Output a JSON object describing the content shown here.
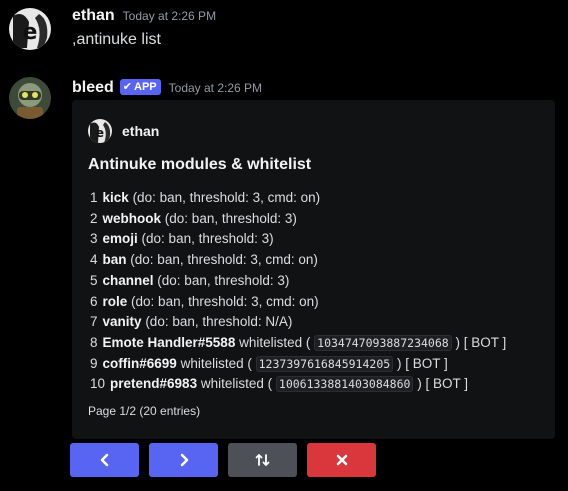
{
  "messages": [
    {
      "username": "ethan",
      "timestamp": "Today at 2:26 PM",
      "content": ",antinuke list"
    },
    {
      "username": "bleed",
      "badge": "APP",
      "timestamp": "Today at 2:26 PM",
      "embed": {
        "author": "ethan",
        "title": "Antinuke modules & whitelist",
        "items": [
          {
            "num": "1",
            "name": "kick",
            "detail": "(do: ban, threshold: 3, cmd: on)"
          },
          {
            "num": "2",
            "name": "webhook",
            "detail": "(do: ban, threshold: 3)"
          },
          {
            "num": "3",
            "name": "emoji",
            "detail": "(do: ban, threshold: 3)"
          },
          {
            "num": "4",
            "name": "ban",
            "detail": "(do: ban, threshold: 3, cmd: on)"
          },
          {
            "num": "5",
            "name": "channel",
            "detail": "(do: ban, threshold: 3)"
          },
          {
            "num": "6",
            "name": "role",
            "detail": "(do: ban, threshold: 3, cmd: on)"
          },
          {
            "num": "7",
            "name": "vanity",
            "detail": "(do: ban, threshold: N/A)"
          },
          {
            "num": "8",
            "name": "Emote Handler#5588",
            "detail": "whitelisted (",
            "id": "1034747093887234068",
            "suffix": ") [",
            "tag": "BOT",
            "end": "]"
          },
          {
            "num": "9",
            "name": "coffin#6699",
            "detail": "whitelisted (",
            "id": "1237397616845914205",
            "suffix": ") [",
            "tag": "BOT",
            "end": "]"
          },
          {
            "num": "10",
            "name": "pretend#6983",
            "detail": "whitelisted (",
            "id": "1006133881403084860",
            "suffix": ") [",
            "tag": "BOT",
            "end": "]"
          }
        ],
        "footer": "Page 1/2 (20 entries)"
      },
      "buttons": [
        {
          "label": "<",
          "icon": "chevron-left-icon",
          "style": "primary"
        },
        {
          "label": ">",
          "icon": "chevron-right-icon",
          "style": "primary"
        },
        {
          "label": "↑↓",
          "icon": "sort-icon",
          "style": "secondary"
        },
        {
          "label": "✕",
          "icon": "close-icon",
          "style": "danger"
        }
      ]
    }
  ],
  "colors": {
    "background": "#000000",
    "embed_bg": "#111214",
    "blurple": "#5865f2",
    "secondary": "#4e5058",
    "danger": "#da373c"
  }
}
